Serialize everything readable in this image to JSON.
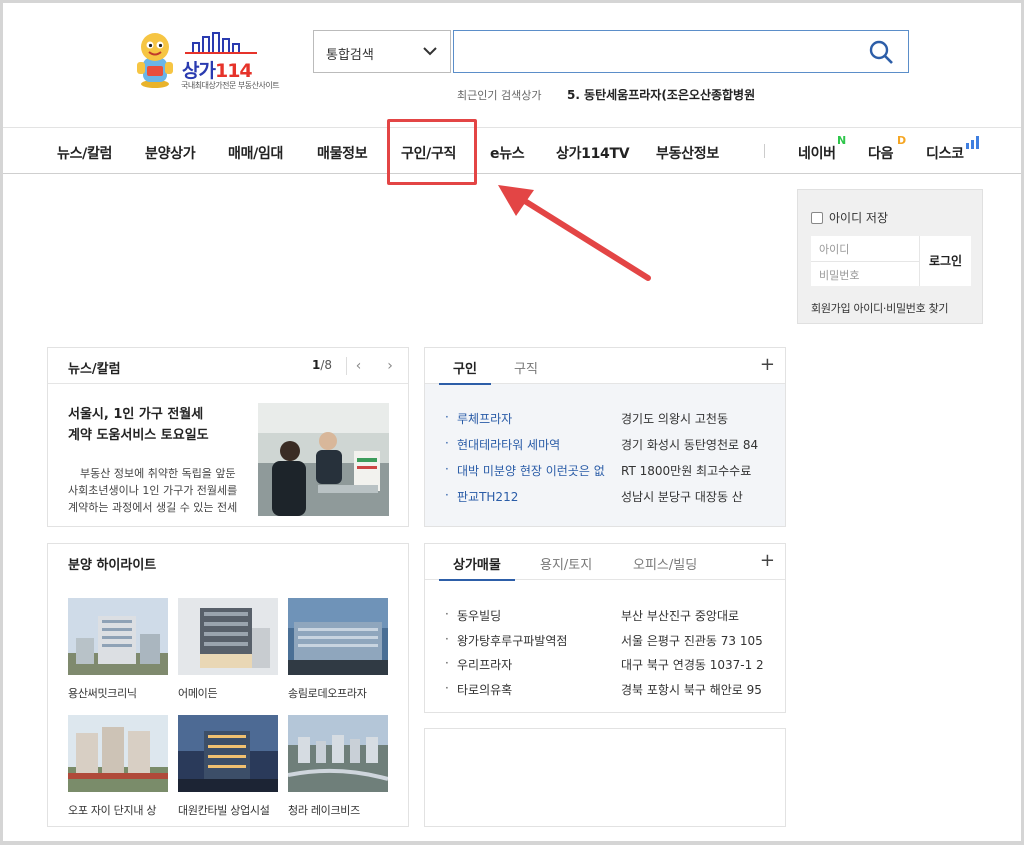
{
  "logo": {
    "brand_main": "상가",
    "brand_num": "114",
    "tagline": "국내최대상가전문 부동산사이트"
  },
  "search": {
    "category": "통합검색",
    "value": "",
    "popular_label": "최근인기 검색상가",
    "popular_item": "5. 동탄세움프라자(조은오산종합병원"
  },
  "nav": {
    "items": [
      "뉴스/칼럼",
      "분양상가",
      "매매/임대",
      "매물정보",
      "구인/구직",
      "e뉴스",
      "상가114TV",
      "부동산정보"
    ],
    "external": [
      {
        "label": "네이버",
        "mark": "N",
        "color": "#2dc64a"
      },
      {
        "label": "다음",
        "mark": "D",
        "color": "#f5a623"
      },
      {
        "label": "디스코",
        "mark": "ıl",
        "color": "#3f7fe0"
      }
    ]
  },
  "colors": {
    "highlight": "#e34545",
    "accent_blue": "#2d5ea8",
    "link_blue": "#2a5ca7"
  },
  "login": {
    "save_label": "아이디 저장",
    "id_placeholder": "아이디",
    "pw_placeholder": "비밀번호",
    "button": "로그인",
    "links": "회원가입 아이디·비밀번호 찾기"
  },
  "news": {
    "title": "뉴스/칼럼",
    "page_current": "1",
    "page_total": "/8",
    "headline_1": "서울시, 1인 가구 전월세",
    "headline_2": "계약 도움서비스 토요일도",
    "summary_1": "부동산 정보에 취약한 독립을 앞둔",
    "summary_2": "사회초년생이나 1인 가구가 전월세를",
    "summary_3": "계약하는 과정에서 생길 수 있는 전세"
  },
  "jobs": {
    "tab_active": "구인",
    "tab_other": "구직",
    "plus": "+",
    "rows": [
      {
        "name": "루체프라자",
        "info": "경기도 의왕시 고천동"
      },
      {
        "name": "현대테라타워 세마역",
        "info": "경기 화성시 동탄영천로 84"
      },
      {
        "name": "대박 미분양 현장 이런곳은 없",
        "info": "RT 1800만원 최고수수료"
      },
      {
        "name": "판교TH212",
        "info": "성남시 분당구 대장동 산"
      }
    ]
  },
  "highlights": {
    "title": "분양 하이라이트",
    "items": [
      {
        "label": "용산써밋크리닉"
      },
      {
        "label": "어메이든"
      },
      {
        "label": "송림로데오프라자"
      },
      {
        "label": "오포 자이 단지내 상"
      },
      {
        "label": "대원칸타빌 상업시설"
      },
      {
        "label": "청라 레이크비즈"
      }
    ]
  },
  "listings": {
    "tabs": [
      "상가매물",
      "용지/토지",
      "오피스/빌딩"
    ],
    "plus": "+",
    "rows": [
      {
        "name": "동우빌딩",
        "info": "부산 부산진구 중앙대로"
      },
      {
        "name": "왕가탕후루구파발역점",
        "info": "서울 은평구 진관동 73 105"
      },
      {
        "name": "우리프라자",
        "info": "대구 북구 연경동 1037-1 2"
      },
      {
        "name": "타로의유혹",
        "info": "경북 포항시 북구 해안로 95"
      }
    ]
  }
}
